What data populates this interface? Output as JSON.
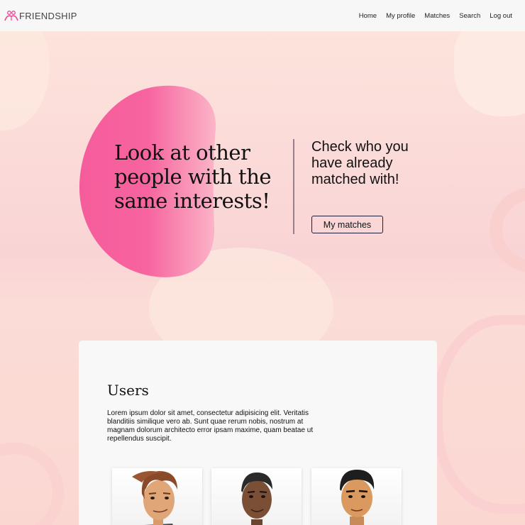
{
  "brand": {
    "name": "FRIENDSHIP",
    "icon": "friendship-logo-icon",
    "accent": "#e8468f"
  },
  "nav": {
    "items": [
      {
        "label": "Home"
      },
      {
        "label": "My profile"
      },
      {
        "label": "Matches"
      },
      {
        "label": "Search"
      },
      {
        "label": "Log out"
      }
    ]
  },
  "hero": {
    "title": "Look at other people with the same interests!",
    "subtitle": "Check who you have already matched with!",
    "button_label": "My matches",
    "blob_color": "#f76aa4"
  },
  "users_section": {
    "title": "Users",
    "text": "Lorem ipsum dolor sit amet, consectetur adipisicing elit. Veritatis blanditiis similique vero ab. Sunt quae rerum nobis, nostrum at magnam dolorum architecto error ipsam maxime, quam beatae ut repellendus suscipit.",
    "users": [
      {
        "avatar": "brown-hair-man-avatar"
      },
      {
        "avatar": "dark-skin-man-avatar"
      },
      {
        "avatar": "businessman-avatar"
      }
    ]
  }
}
